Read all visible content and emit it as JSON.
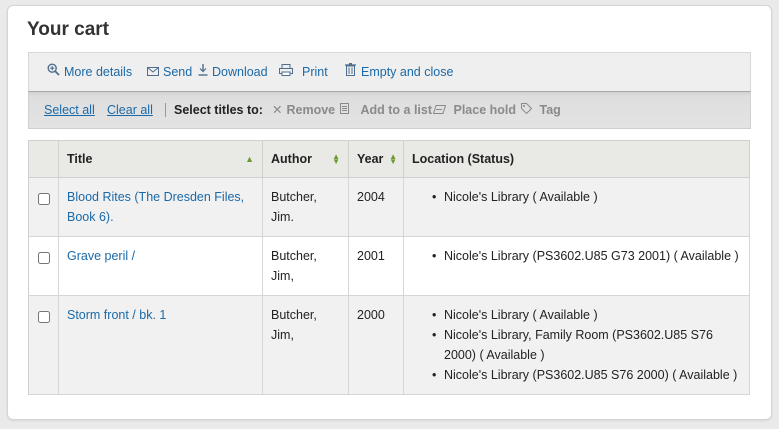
{
  "page": {
    "title": "Your cart"
  },
  "toolbar": {
    "more_details": "More details",
    "send": "Send",
    "download": "Download",
    "print": "Print",
    "empty": "Empty and close"
  },
  "selection": {
    "select_all": "Select all",
    "clear_all": "Clear all",
    "label": "Select titles to:",
    "remove": "Remove",
    "add_to_list": "Add to a list",
    "place_hold": "Place hold",
    "tag": "Tag"
  },
  "table": {
    "headers": {
      "title": "Title",
      "author": "Author",
      "year": "Year",
      "location": "Location (Status)"
    },
    "rows": [
      {
        "title": "Blood Rites (The Dresden Files, Book 6).",
        "author": "Butcher, Jim.",
        "year": "2004",
        "locations": [
          "Nicole's Library ( Available )"
        ]
      },
      {
        "title": "Grave peril /",
        "author": "Butcher, Jim,",
        "year": "2001",
        "locations": [
          "Nicole's Library (PS3602.U85 G73 2001) ( Available )"
        ]
      },
      {
        "title": "Storm front / bk. 1",
        "author": "Butcher, Jim,",
        "year": "2000",
        "locations": [
          "Nicole's Library ( Available )",
          "Nicole's Library, Family Room (PS3602.U85 S76 2000) ( Available )",
          "Nicole's Library (PS3602.U85 S76 2000) ( Available )"
        ]
      }
    ]
  },
  "colors": {
    "link": "#1a69a8",
    "header_bg": "#e9eae5",
    "odd_row": "#f1f1f1",
    "sort_arrow": "#6d9a2f"
  },
  "icons": [
    "magnifier-plus-icon",
    "envelope-icon",
    "download-icon",
    "printer-icon",
    "trash-icon",
    "remove-x-icon",
    "list-icon",
    "hold-icon",
    "tag-icon",
    "sort-up-icon",
    "sort-both-icon"
  ]
}
